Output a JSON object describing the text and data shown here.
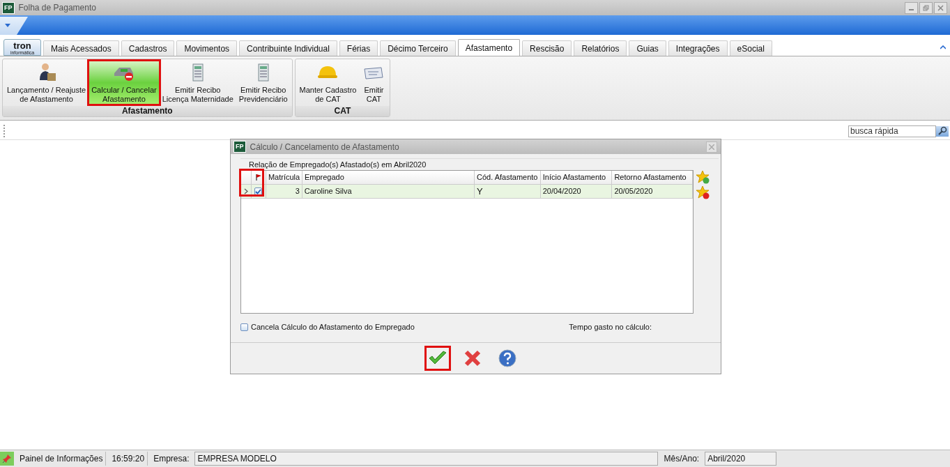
{
  "window": {
    "app_icon": "FP",
    "title": "Folha de Pagamento"
  },
  "quick_menu": {
    "kind": "dropdown"
  },
  "logo": {
    "name": "tron",
    "sub": "informática"
  },
  "tabs": [
    {
      "label": "Mais Acessados",
      "selected": false
    },
    {
      "label": "Cadastros",
      "selected": false
    },
    {
      "label": "Movimentos",
      "selected": false
    },
    {
      "label": "Contribuinte Individual",
      "selected": false
    },
    {
      "label": "Férias",
      "selected": false
    },
    {
      "label": "Décimo Terceiro",
      "selected": false
    },
    {
      "label": "Afastamento",
      "selected": true
    },
    {
      "label": "Rescisão",
      "selected": false
    },
    {
      "label": "Relatórios",
      "selected": false
    },
    {
      "label": "Guias",
      "selected": false
    },
    {
      "label": "Integrações",
      "selected": false
    },
    {
      "label": "eSocial",
      "selected": false
    }
  ],
  "ribbon_groups": [
    {
      "title": "Afastamento",
      "buttons": [
        {
          "kind": "person",
          "lines": [
            "Lançamento / Reajuste",
            "de Afastamento"
          ],
          "selected": false,
          "highlighted": false
        },
        {
          "kind": "calculator",
          "lines": [
            "Calcular / Cancelar",
            "Afastamento"
          ],
          "selected": true,
          "highlighted": true
        },
        {
          "kind": "receipt",
          "lines": [
            "Emitir Recibo",
            "Licença Maternidade"
          ],
          "selected": false,
          "highlighted": false
        },
        {
          "kind": "receipt",
          "lines": [
            "Emitir Recibo",
            "Previdenciário"
          ],
          "selected": false,
          "highlighted": false
        }
      ]
    },
    {
      "title": "CAT",
      "buttons": [
        {
          "kind": "helmet",
          "lines": [
            "Manter Cadastro",
            "de CAT"
          ],
          "selected": false,
          "highlighted": false
        },
        {
          "kind": "card",
          "lines": [
            "Emitir",
            "CAT"
          ],
          "selected": false,
          "highlighted": false
        }
      ]
    }
  ],
  "search": {
    "placeholder": "busca rápida"
  },
  "dialog": {
    "app_icon": "FP",
    "title": "Cálculo / Cancelamento de Afastamento",
    "caption": "Relação de Empregado(s) Afastado(s) em Abril2020",
    "check_column_highlighted": true,
    "columns": [
      "Matrícula",
      "Empregado",
      "Cód. Afastamento",
      "Início Afastamento",
      "Retorno Afastamento"
    ],
    "rows": [
      {
        "cells": [
          "3",
          "Caroline Silva",
          "Y",
          "20/04/2020",
          "20/05/2020"
        ],
        "checked": true,
        "selected": true
      }
    ],
    "cancel_option": {
      "label": "Cancela Cálculo do Afastamento do Empregado",
      "checked": false
    },
    "time_label": "Tempo gasto no cálculo:",
    "buttons": [
      {
        "kind": "ok",
        "highlighted": true
      },
      {
        "kind": "cancel",
        "highlighted": false
      },
      {
        "kind": "help",
        "highlighted": false
      }
    ]
  },
  "status_bar": {
    "panel": "Painel de Informações",
    "time": "16:59:20",
    "company_label": "Empresa:",
    "company": "EMPRESA MODELO",
    "period_label": "Mês/Ano:",
    "period": "Abril/2020"
  }
}
